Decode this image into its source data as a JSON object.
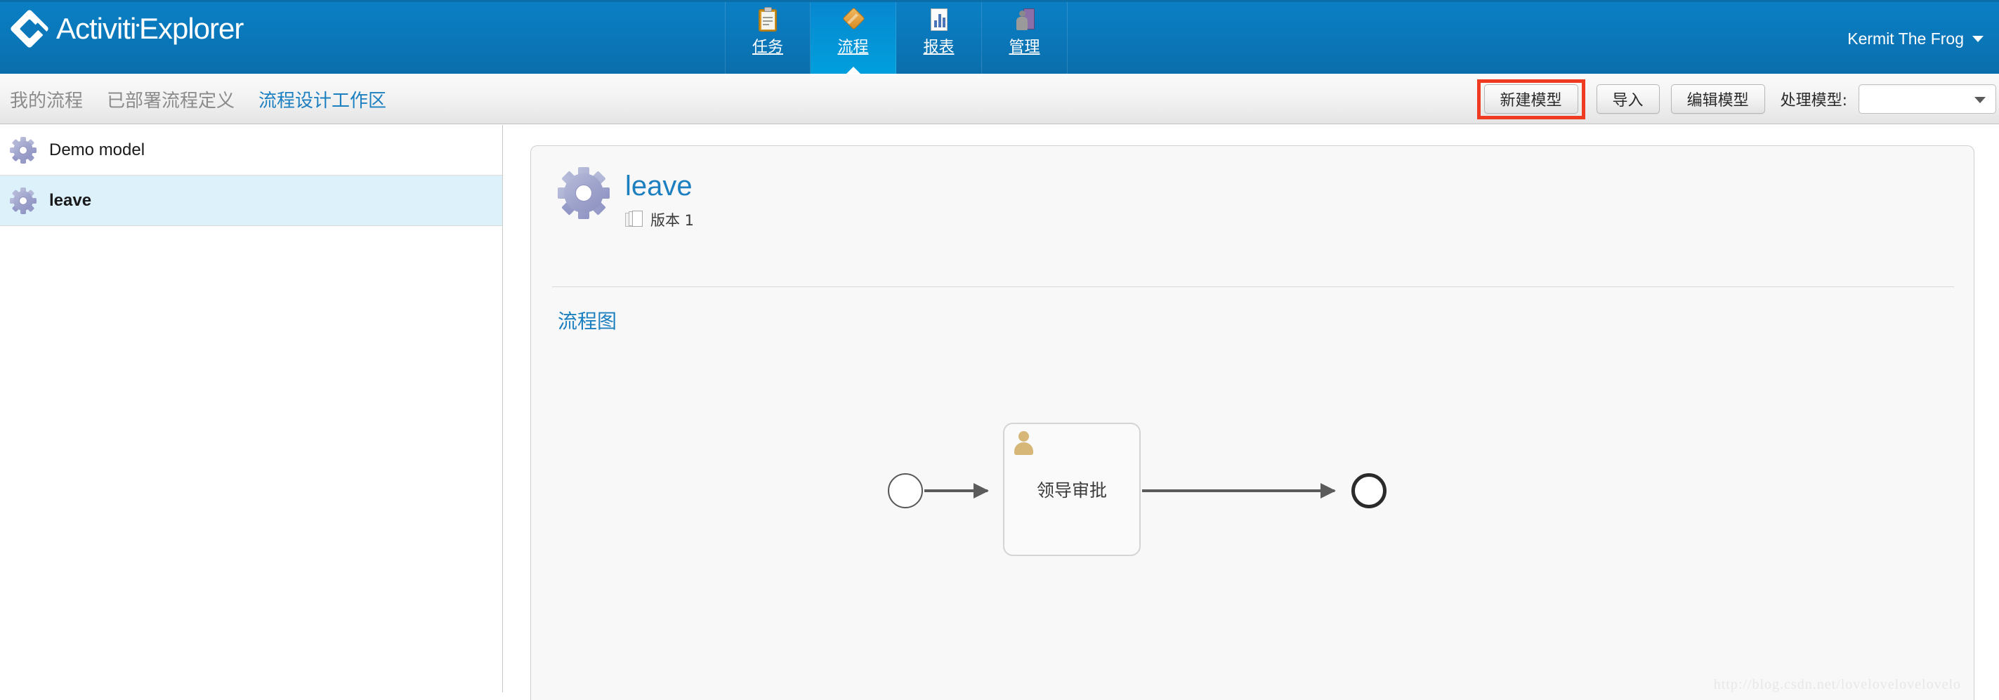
{
  "header": {
    "brand": "Activiti",
    "brand_suffix": "Explorer",
    "logo_icon": "diamond-logo-icon",
    "nav": [
      {
        "label": "任务",
        "icon": "clipboard-icon",
        "active": false
      },
      {
        "label": "流程",
        "icon": "diamond-icon",
        "active": true
      },
      {
        "label": "报表",
        "icon": "bar-chart-icon",
        "active": false
      },
      {
        "label": "管理",
        "icon": "manage-icon",
        "active": false
      }
    ],
    "user": {
      "name": "Kermit The Frog",
      "caret_icon": "caret-down-icon"
    },
    "brand_color": "#0a78bb",
    "active_tab_color": "#00a0dd"
  },
  "subbar": {
    "tabs": [
      {
        "label": "我的流程",
        "active": false
      },
      {
        "label": "已部署流程定义",
        "active": false
      },
      {
        "label": "流程设计工作区",
        "active": true
      }
    ],
    "toolbar": {
      "new_model_label": "新建模型",
      "import_label": "导入",
      "edit_model_label": "编辑模型",
      "process_model_label": "处理模型:",
      "select_value": "",
      "select_caret_icon": "chevron-down-icon",
      "highlight_color": "#ee3b22"
    }
  },
  "sidebar": {
    "items": [
      {
        "label": "Demo model",
        "icon": "gear-icon",
        "selected": false
      },
      {
        "label": "leave",
        "icon": "gear-icon",
        "selected": true
      }
    ],
    "selected_color": "#ddf1fb"
  },
  "detail": {
    "icon": "gear-icon",
    "title": "leave",
    "title_color": "#1c7fc0",
    "version_label": "版本 1",
    "version_icon": "pages-icon",
    "diagram_link": "流程图"
  },
  "diagram": {
    "type": "bpmn",
    "nodes": [
      {
        "id": "start",
        "kind": "start-event",
        "label": ""
      },
      {
        "id": "task1",
        "kind": "user-task",
        "label": "领导审批",
        "icon": "user-icon"
      },
      {
        "id": "end",
        "kind": "end-event",
        "label": ""
      }
    ],
    "flows": [
      {
        "from": "start",
        "to": "task1"
      },
      {
        "from": "task1",
        "to": "end"
      }
    ]
  },
  "watermark": {
    "text": "http://blog.csdn.net/lovelovelovelovelo"
  }
}
